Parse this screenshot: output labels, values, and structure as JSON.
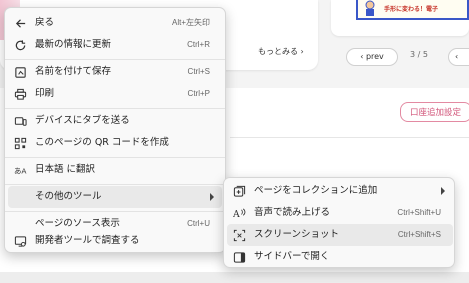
{
  "background": {
    "promo_text": "手形に変わる！電子",
    "more_link": "もっとみる ›",
    "pager": {
      "prev": "‹ prev",
      "count": "3 / 5",
      "next": "‹"
    },
    "pink_button": "口座追加設定"
  },
  "menu": {
    "items": [
      {
        "label": "戻る",
        "shortcut": "Alt+左矢印",
        "icon": "back-arrow-icon"
      },
      {
        "label": "最新の情報に更新",
        "shortcut": "Ctrl+R",
        "icon": "refresh-icon"
      },
      {
        "label": "名前を付けて保存",
        "shortcut": "Ctrl+S",
        "icon": "save-icon"
      },
      {
        "label": "印刷",
        "shortcut": "Ctrl+P",
        "icon": "print-icon"
      },
      {
        "label": "デバイスにタブを送る",
        "shortcut": "",
        "icon": "send-device-icon"
      },
      {
        "label": "このページの QR コードを作成",
        "shortcut": "",
        "icon": "qr-code-icon"
      },
      {
        "label": "日本語 に翻訳",
        "shortcut": "",
        "icon": "translate-icon"
      },
      {
        "label": "その他のツール",
        "shortcut": "",
        "icon": "",
        "has_submenu": true,
        "highlighted": true
      },
      {
        "label": "ページのソース表示",
        "shortcut": "Ctrl+U",
        "icon": ""
      },
      {
        "label": "開発者ツールで調査する",
        "shortcut": "",
        "icon": "devtools-icon"
      }
    ]
  },
  "submenu": {
    "items": [
      {
        "label": "ページをコレクションに追加",
        "shortcut": "",
        "icon": "collections-icon",
        "has_submenu": true
      },
      {
        "label": "音声で読み上げる",
        "shortcut": "Ctrl+Shift+U",
        "icon": "read-aloud-icon"
      },
      {
        "label": "スクリーンショット",
        "shortcut": "Ctrl+Shift+S",
        "icon": "screenshot-icon",
        "highlighted": true
      },
      {
        "label": "サイドバーで開く",
        "shortcut": "",
        "icon": "sidebar-icon"
      }
    ]
  }
}
